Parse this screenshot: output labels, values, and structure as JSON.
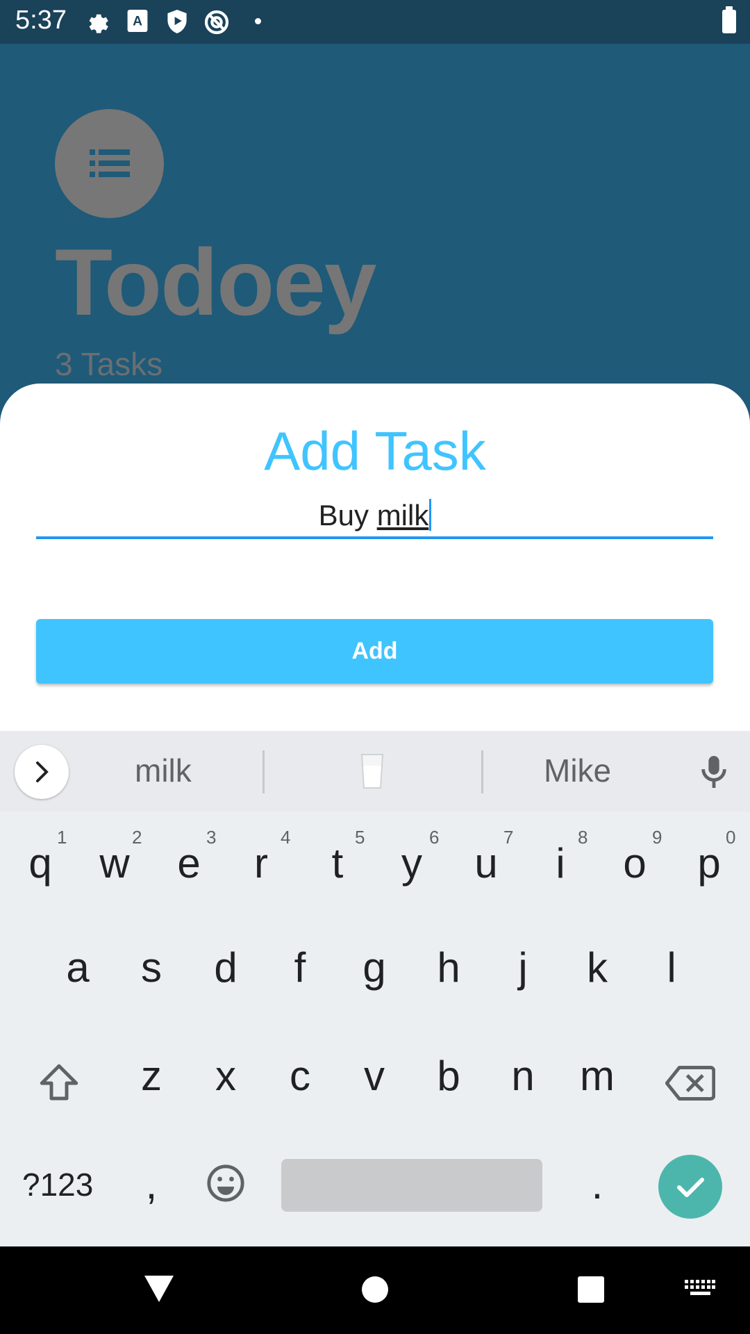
{
  "status_bar": {
    "time": "5:37"
  },
  "app": {
    "title": "Todoey",
    "task_count": "3 Tasks"
  },
  "sheet": {
    "title": "Add Task",
    "input_value_prefix": "Buy ",
    "input_value_underlined": "milk",
    "add_button_label": "Add"
  },
  "keyboard": {
    "suggestions": [
      "milk",
      "Mike"
    ],
    "row1": [
      "q",
      "w",
      "e",
      "r",
      "t",
      "y",
      "u",
      "i",
      "o",
      "p"
    ],
    "row1_hints": [
      "1",
      "2",
      "3",
      "4",
      "5",
      "6",
      "7",
      "8",
      "9",
      "0"
    ],
    "row2": [
      "a",
      "s",
      "d",
      "f",
      "g",
      "h",
      "j",
      "k",
      "l"
    ],
    "row3": [
      "z",
      "x",
      "c",
      "v",
      "b",
      "n",
      "m"
    ],
    "symbols_key": "?123",
    "comma_key": ",",
    "period_key": "."
  },
  "colors": {
    "accent": "#40c4ff",
    "underline": "#2196f3",
    "enter": "#4db6ac"
  }
}
